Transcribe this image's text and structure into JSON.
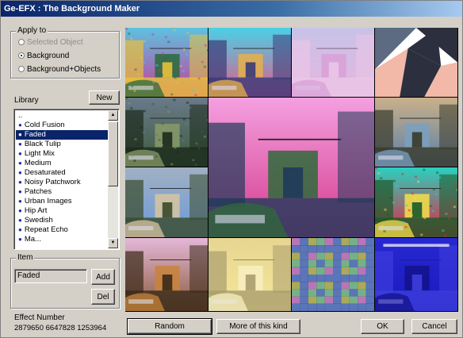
{
  "window": {
    "title": "Ge-EFX : The Background Maker"
  },
  "apply_to": {
    "legend": "Apply to",
    "options": [
      {
        "label": "Selected Object",
        "selected": false,
        "disabled": true
      },
      {
        "label": "Background",
        "selected": true,
        "disabled": false
      },
      {
        "label": "Background+Objects",
        "selected": false,
        "disabled": false
      }
    ]
  },
  "library": {
    "label": "Library",
    "new_button": "New",
    "parent_item": "..",
    "items": [
      "Cold Fusion",
      "Faded",
      "Black Tulip",
      "Light Mix",
      "Medium",
      "Desaturated",
      "Noisy Patchwork",
      "Patches",
      "Urban Images",
      "Hip Art",
      "Swedish",
      "Repeat Echo",
      "Ma..."
    ],
    "selected_item": "Faded"
  },
  "item_group": {
    "legend": "Item",
    "value": "Faded",
    "add_button": "Add",
    "del_button": "Del"
  },
  "effect_number": {
    "label": "Effect Number",
    "value": "2879650 6647828 1253964"
  },
  "buttons": {
    "random": "Random",
    "more_of_this_kind": "More of this kind",
    "ok": "OK",
    "cancel": "Cancel"
  },
  "preview_tiles": [
    {
      "name": "preview-tile-1",
      "style": "neon-collage",
      "colors": [
        "#c93a9a",
        "#5cc2e0",
        "#e8c23a",
        "#2a6b3a"
      ]
    },
    {
      "name": "preview-tile-2",
      "style": "sunset-street",
      "colors": [
        "#e25a8a",
        "#4bd0e6",
        "#3a3a78",
        "#e6b04a"
      ]
    },
    {
      "name": "preview-tile-3",
      "style": "pastel-wash",
      "colors": [
        "#f2c7e8",
        "#b8e0f4",
        "#f8e6f4",
        "#d9a0d8"
      ]
    },
    {
      "name": "preview-tile-4",
      "style": "geometric-triangles",
      "colors": [
        "#2c2f3e",
        "#f2b8a8",
        "#5c6b82",
        "#ffffff"
      ]
    },
    {
      "name": "preview-tile-5",
      "style": "dark-noisy",
      "colors": [
        "#3b5a3b",
        "#6a7a8a",
        "#1c2a1c",
        "#8a9a6a"
      ]
    },
    {
      "name": "preview-tile-6",
      "style": "main-arch-magenta",
      "colors": [
        "#d43a8c",
        "#f4a0e0",
        "#1f3a5a",
        "#2f6a3a"
      ]
    },
    {
      "name": "preview-tile-7",
      "style": "natural-street",
      "colors": [
        "#5a7fa8",
        "#c9b08a",
        "#3a3a2a",
        "#7aa0c0"
      ]
    },
    {
      "name": "preview-tile-8",
      "style": "natural-arch",
      "colors": [
        "#6a9ad8",
        "#a0b0c4",
        "#3a4a2a",
        "#d8c4a0"
      ]
    },
    {
      "name": "preview-tile-9",
      "style": "red-psychedelic",
      "colors": [
        "#e8203a",
        "#2ad0c0",
        "#1a5a2a",
        "#f4e04a"
      ]
    },
    {
      "name": "preview-tile-10",
      "style": "warm-sepia",
      "colors": [
        "#8a5a3a",
        "#e4b8d8",
        "#3a2a1a",
        "#c8843a"
      ]
    },
    {
      "name": "preview-tile-11",
      "style": "yellow-faded",
      "colors": [
        "#f4e07a",
        "#d8c06a",
        "#6a5a2a",
        "#f8f0c0"
      ]
    },
    {
      "name": "preview-tile-12",
      "style": "pixel-mosaic",
      "colors": [
        "#d88ad8",
        "#8ad0a0",
        "#c8c86a",
        "#6a8ad8"
      ]
    },
    {
      "name": "preview-tile-13",
      "style": "deep-blue",
      "colors": [
        "#1a1ac0",
        "#3a3ae8",
        "#6a6aff",
        "#0a0a4a"
      ]
    }
  ]
}
